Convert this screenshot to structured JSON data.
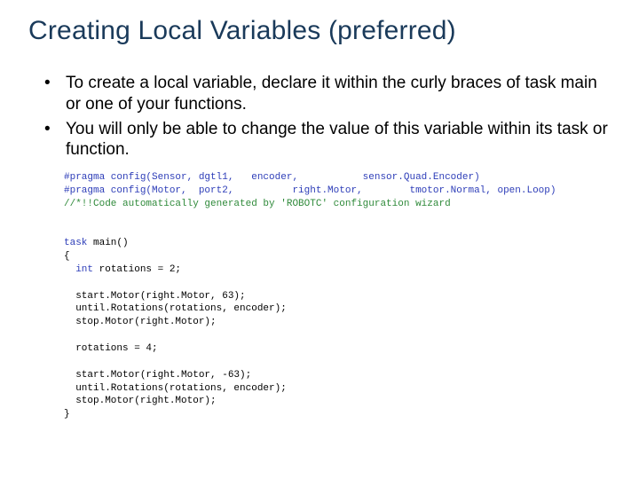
{
  "title": "Creating Local Variables (preferred)",
  "bullets": [
    "To create a local variable, declare it within the curly braces of task main or one of your functions.",
    "You will only be able to change the value of this variable within its task or function."
  ],
  "code": {
    "l1_a": "#pragma config(Sensor, dgtl1,   encoder,           sensor.Quad.Encoder)",
    "l2_a": "#pragma config(Motor,  port2,          right.Motor,        tmotor.Normal, open.Loop)",
    "l3_a": "//*!!Code automatically generated by 'ROBOTC' configuration wizard",
    "blank": "",
    "l4_kw": "task",
    "l4_rest": " main()",
    "l5": "{",
    "l6_kw": "  int",
    "l6_rest": " rotations = 2;",
    "l7": "  start.Motor(right.Motor, 63);",
    "l8": "  until.Rotations(rotations, encoder);",
    "l9": "  stop.Motor(right.Motor);",
    "l10": "  rotations = 4;",
    "l11": "  start.Motor(right.Motor, -63);",
    "l12": "  until.Rotations(rotations, encoder);",
    "l13": "  stop.Motor(right.Motor);",
    "l14": "}"
  }
}
